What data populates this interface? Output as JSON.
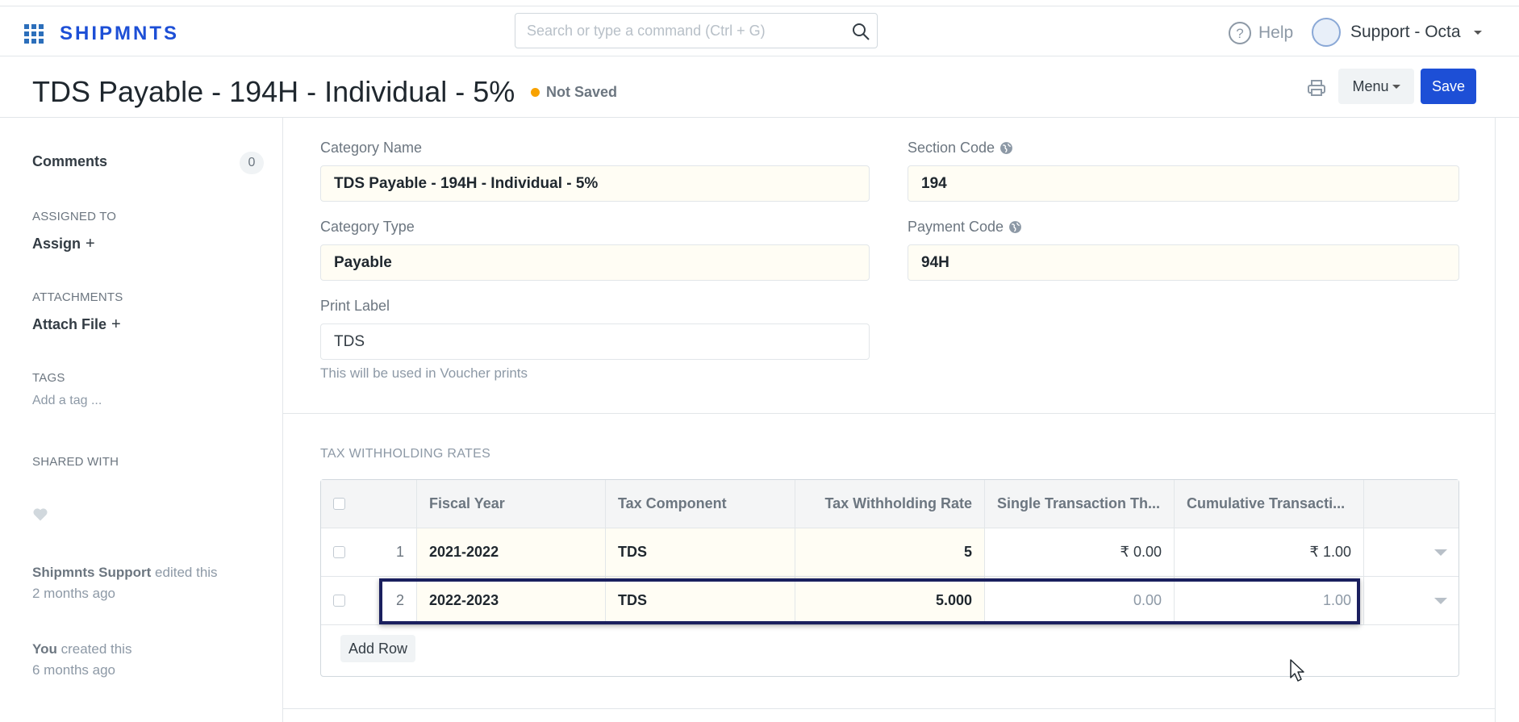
{
  "navbar": {
    "brand": "SHIPMNTS",
    "search_placeholder": "Search or type a command (Ctrl + G)",
    "help_label": "Help",
    "user_label": "Support - Octa"
  },
  "page": {
    "title": "TDS Payable - 194H - Individual - 5%",
    "status": "Not Saved",
    "menu_label": "Menu",
    "save_label": "Save"
  },
  "sidebar": {
    "comments_label": "Comments",
    "comments_count": "0",
    "assigned_heading": "ASSIGNED TO",
    "assign_label": "Assign",
    "attachments_heading": "ATTACHMENTS",
    "attach_label": "Attach File",
    "tags_heading": "TAGS",
    "tag_placeholder": "Add a tag ...",
    "shared_heading": "SHARED WITH",
    "activity": [
      {
        "actor": "Shipmnts Support",
        "action": " edited this",
        "time": "2 months ago"
      },
      {
        "actor": "You",
        "action": " created this",
        "time": "6 months ago"
      }
    ]
  },
  "form": {
    "category_name_label": "Category Name",
    "category_name_value": "TDS Payable - 194H - Individual - 5%",
    "section_code_label": "Section Code",
    "section_code_value": "194",
    "category_type_label": "Category Type",
    "category_type_value": "Payable",
    "payment_code_label": "Payment Code",
    "payment_code_value": "94H",
    "print_label_label": "Print Label",
    "print_label_value": "TDS",
    "print_label_help": "This will be used in Voucher prints"
  },
  "rates": {
    "heading": "TAX WITHHOLDING RATES",
    "columns": [
      "Fiscal Year",
      "Tax Component",
      "Tax Withholding Rate",
      "Single Transaction Th...",
      "Cumulative Transacti..."
    ],
    "rows": [
      {
        "idx": "1",
        "fiscal_year": "2021-2022",
        "component": "TDS",
        "rate": "5",
        "single": "₹ 0.00",
        "cumulative": "₹ 1.00"
      },
      {
        "idx": "2",
        "fiscal_year": "2022-2023",
        "component": "TDS",
        "rate": "5.000",
        "single": "0.00",
        "cumulative": "1.00"
      }
    ],
    "add_row_label": "Add Row"
  },
  "colors": {
    "brand": "#1d4fd6",
    "status_dot": "#f8a200",
    "field_bg": "#fffdf4"
  }
}
